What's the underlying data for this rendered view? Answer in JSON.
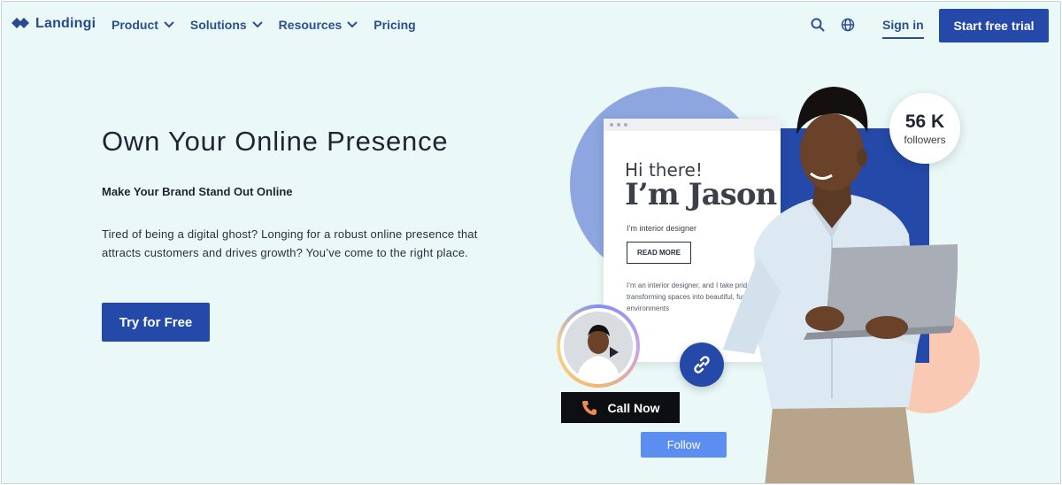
{
  "nav": {
    "brand": "Landingi",
    "menu": [
      {
        "label": "Product",
        "has_dropdown": true
      },
      {
        "label": "Solutions",
        "has_dropdown": true
      },
      {
        "label": "Resources",
        "has_dropdown": true
      },
      {
        "label": "Pricing",
        "has_dropdown": false
      }
    ],
    "sign_in": "Sign in",
    "cta": "Start free trial"
  },
  "hero": {
    "title": "Own Your Online Presence",
    "subtitle": "Make Your Brand Stand Out Online",
    "description": "Tired of being a digital ghost? Longing for a robust online presence that attracts customers and drives growth? You’ve come to the right place.",
    "cta": "Try for Free"
  },
  "illustration": {
    "greeting": "Hi there!",
    "name": "I’m Jason",
    "role": "I’m interior designer",
    "read_more": "READ MORE",
    "paragraph": "I’m an interior designer, and I take pride in transforming spaces into beautiful, functional environments",
    "followers_count": "56 K",
    "followers_label": "followers",
    "call_now": "Call Now",
    "follow": "Follow"
  },
  "colors": {
    "brand": "#2449a8",
    "background": "#eaf8f8",
    "nav_text": "#2d4f8e",
    "follow": "#5c8ef2",
    "peach": "#f9c9b4",
    "lavender": "#8da6df"
  },
  "icons": [
    "landingi-logo-icon",
    "chevron-down-icon",
    "search-icon",
    "globe-icon",
    "phone-icon",
    "link-icon"
  ]
}
